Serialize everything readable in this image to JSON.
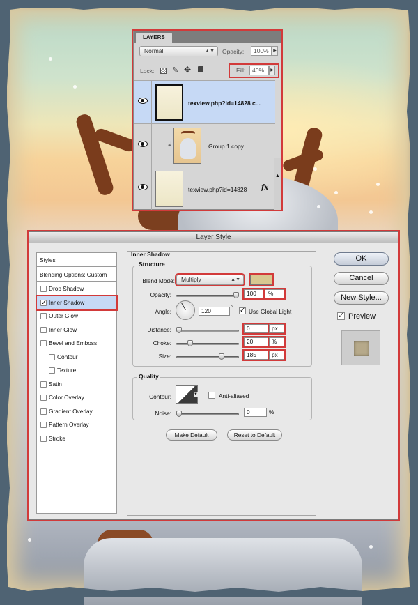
{
  "colors": {
    "highlight_red": "#d23a3a",
    "selection_blue": "#c6d9f5",
    "shadow_swatch": "#d8c890"
  },
  "layers_panel": {
    "tab_label": "LAYERS",
    "blend_mode": "Normal",
    "opacity_label": "Opacity:",
    "opacity_value": "100%",
    "lock_label": "Lock:",
    "fill_label": "Fill:",
    "fill_value": "40%",
    "layers": [
      {
        "name": "texview.php?id=14828 c...",
        "selected": true,
        "thumb": "paper-texture"
      },
      {
        "name": "Group 1 copy",
        "selected": false,
        "thumb": "yeti-illustration"
      },
      {
        "name": "texview.php?id=14828",
        "selected": false,
        "thumb": "paper-texture",
        "fx": "fx"
      }
    ]
  },
  "layer_style": {
    "title": "Layer Style",
    "styles_header": "Styles",
    "blending_options": "Blending Options: Custom",
    "style_items": [
      {
        "label": "Drop Shadow",
        "checked": false,
        "indent": false
      },
      {
        "label": "Inner Shadow",
        "checked": true,
        "indent": false,
        "selected": true
      },
      {
        "label": "Outer Glow",
        "checked": false,
        "indent": false
      },
      {
        "label": "Inner Glow",
        "checked": false,
        "indent": false
      },
      {
        "label": "Bevel and Emboss",
        "checked": false,
        "indent": false
      },
      {
        "label": "Contour",
        "checked": false,
        "indent": true
      },
      {
        "label": "Texture",
        "checked": false,
        "indent": true
      },
      {
        "label": "Satin",
        "checked": false,
        "indent": false
      },
      {
        "label": "Color Overlay",
        "checked": false,
        "indent": false
      },
      {
        "label": "Gradient Overlay",
        "checked": false,
        "indent": false
      },
      {
        "label": "Pattern Overlay",
        "checked": false,
        "indent": false
      },
      {
        "label": "Stroke",
        "checked": false,
        "indent": false
      }
    ],
    "section_title": "Inner Shadow",
    "structure": {
      "title": "Structure",
      "blend_mode_label": "Blend Mode:",
      "blend_mode_value": "Multiply",
      "opacity_label": "Opacity:",
      "opacity_value": "100",
      "opacity_unit": "%",
      "opacity_level": 1.0,
      "angle_label": "Angle:",
      "angle_value": "120",
      "angle_unit": "°",
      "use_global_light_label": "Use Global Light",
      "use_global_light": true,
      "distance_label": "Distance:",
      "distance_value": "0",
      "distance_unit": "px",
      "distance_level": 0.0,
      "choke_label": "Choke:",
      "choke_value": "20",
      "choke_unit": "%",
      "choke_level": 0.2,
      "size_label": "Size:",
      "size_value": "185",
      "size_unit": "px",
      "size_level": 0.74
    },
    "quality": {
      "title": "Quality",
      "contour_label": "Contour:",
      "anti_aliased_label": "Anti-aliased",
      "anti_aliased": false,
      "noise_label": "Noise:",
      "noise_value": "0",
      "noise_unit": "%",
      "noise_level": 0.0
    },
    "make_default_label": "Make Default",
    "reset_default_label": "Reset to Default",
    "ok_label": "OK",
    "cancel_label": "Cancel",
    "new_style_label": "New Style...",
    "preview_label": "Preview",
    "preview_checked": true
  }
}
